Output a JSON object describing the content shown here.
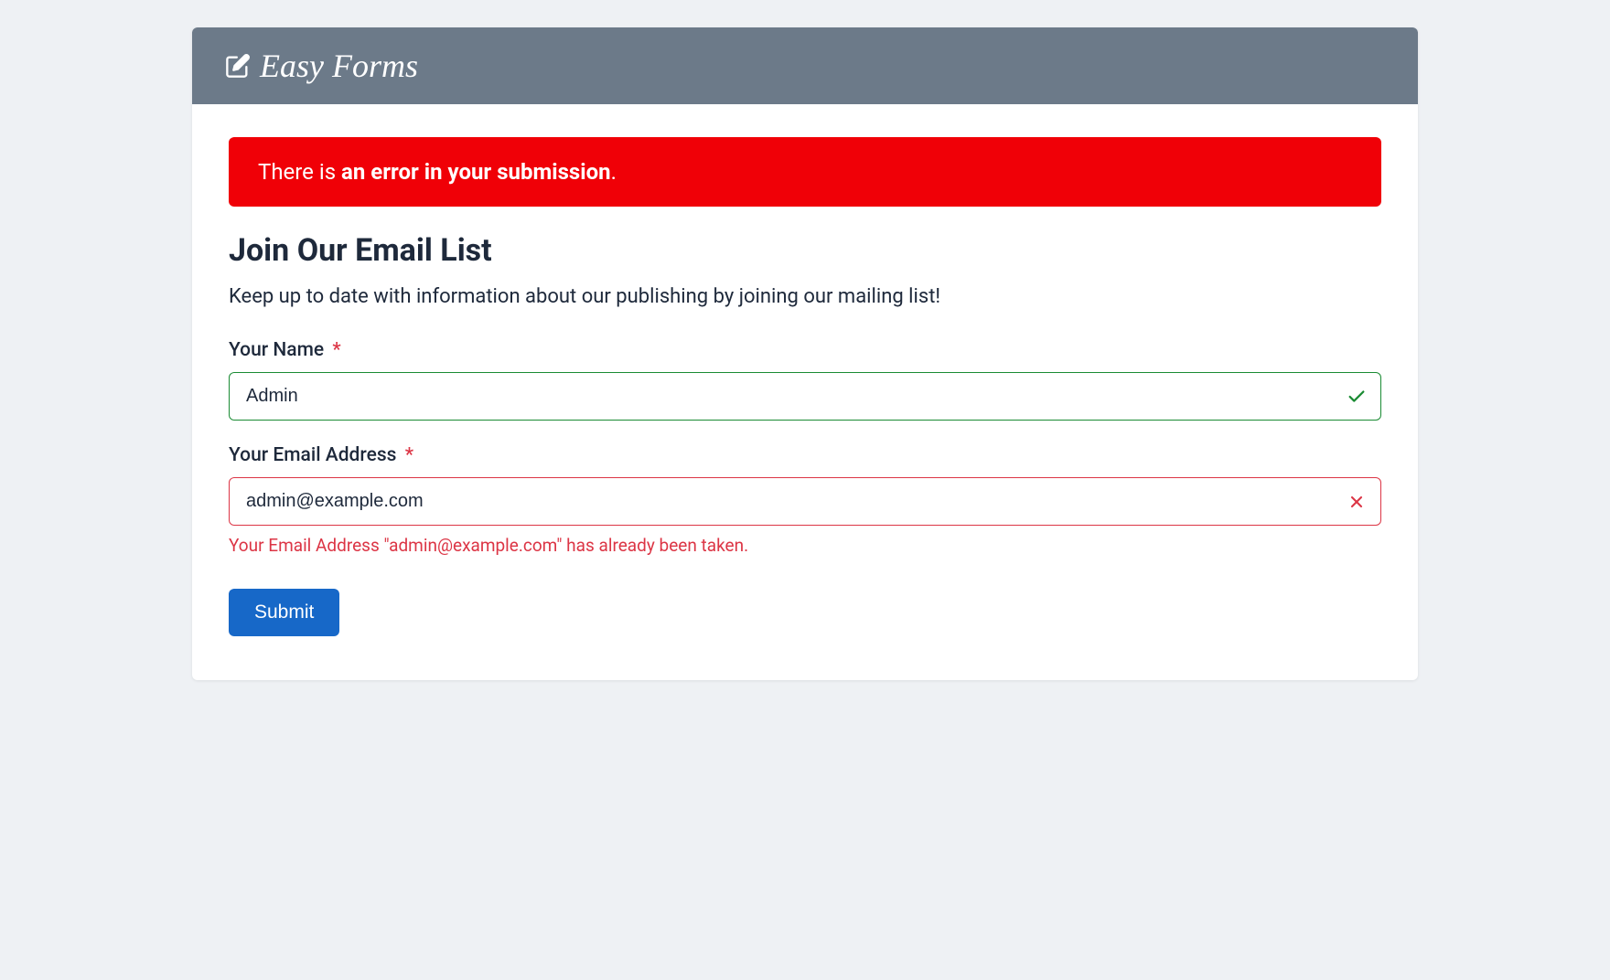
{
  "brand": {
    "name": "Easy Forms"
  },
  "alert": {
    "prefix": "There is ",
    "bold": "an error in your submission",
    "suffix": "."
  },
  "form": {
    "title": "Join Our Email List",
    "description": "Keep up to date with information about our publishing by joining our mailing list!",
    "fields": {
      "name": {
        "label": "Your Name",
        "required": "*",
        "value": "Admin"
      },
      "email": {
        "label": "Your Email Address",
        "required": "*",
        "value": "admin@example.com",
        "error": "Your Email Address \"admin@example.com\" has already been taken."
      }
    },
    "submit_label": "Submit"
  }
}
